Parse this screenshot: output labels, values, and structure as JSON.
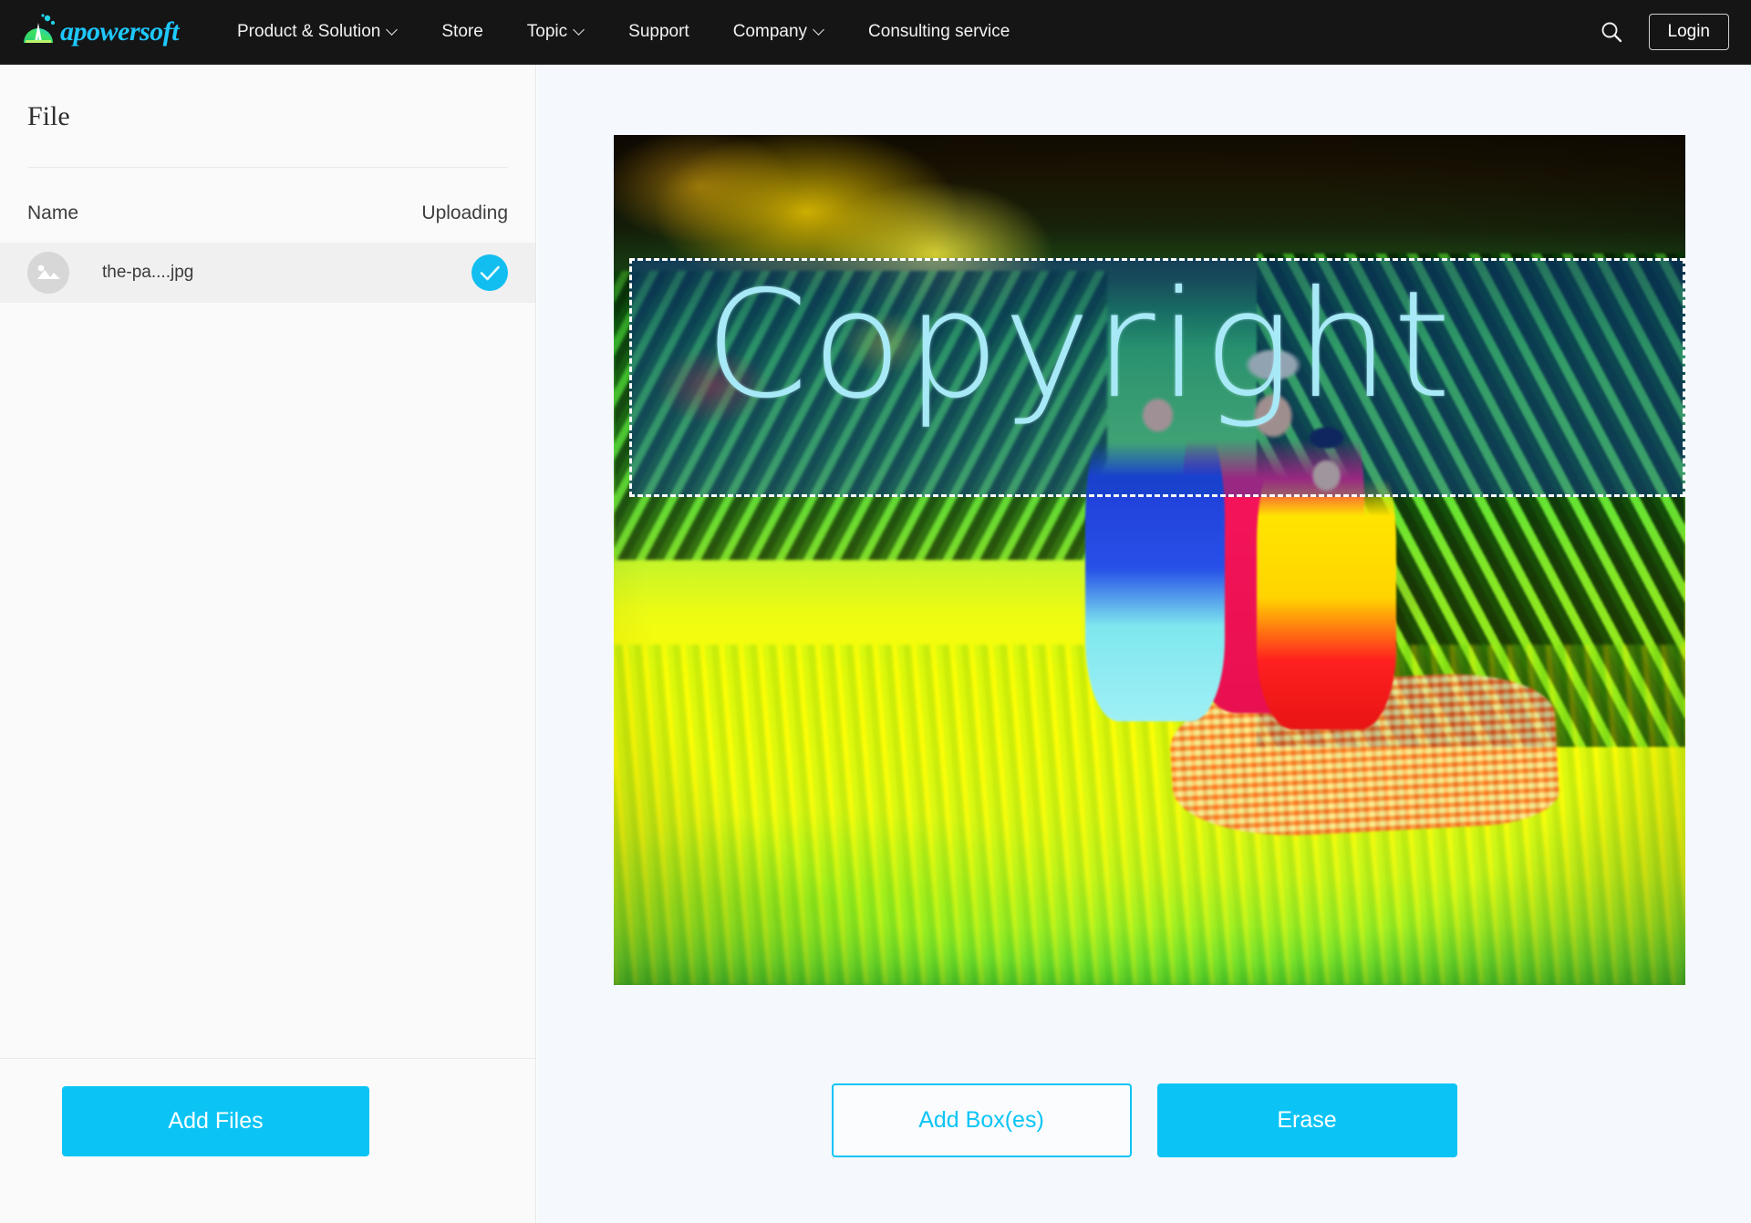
{
  "nav": {
    "brand_name": "apowersoft",
    "brand_icon": "apowersoft-logo-icon",
    "items": [
      {
        "label": "Product & Solution",
        "has_caret": true
      },
      {
        "label": "Store",
        "has_caret": false
      },
      {
        "label": "Topic",
        "has_caret": true
      },
      {
        "label": "Support",
        "has_caret": false
      },
      {
        "label": "Company",
        "has_caret": true
      },
      {
        "label": "Consulting service",
        "has_caret": false
      }
    ],
    "search_icon": "search-icon",
    "login_label": "Login",
    "background_color": "#151515",
    "accent_color": "#1ec8ff"
  },
  "sidebar": {
    "title": "File",
    "columns": {
      "name": "Name",
      "status": "Uploading"
    },
    "files": [
      {
        "name": "the-pa....jpg",
        "thumb_icon": "image-placeholder-icon",
        "status_icon": "check-circle-icon",
        "status": "uploaded"
      }
    ],
    "add_files_label": "Add Files",
    "button_color": "#0bc4f5"
  },
  "editor": {
    "watermark_text": "Copyright",
    "watermark_color": "#a8e9f7",
    "selection_box": {
      "style": "dashed-white",
      "fill_color": "rgba(16,70,190,0.40)"
    },
    "add_boxes_label": "Add Box(es)",
    "erase_label": "Erase",
    "outline_button_color": "#0bc4f5",
    "solid_button_color": "#0bc4f5",
    "canvas_background": "#f5f8fd"
  }
}
